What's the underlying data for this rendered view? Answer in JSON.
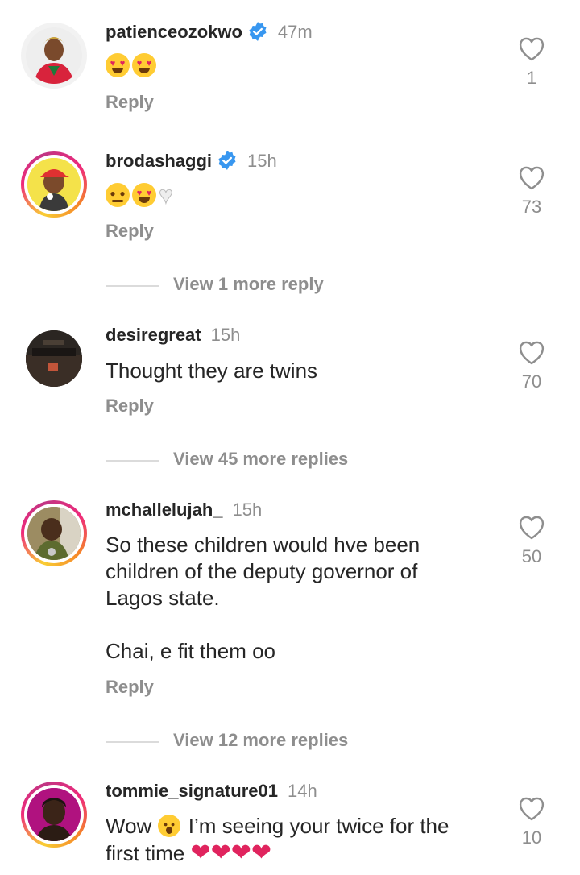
{
  "comments": [
    {
      "username": "patienceozokwo",
      "verified": true,
      "time": "47m",
      "text": "",
      "emojis": [
        "heart-eyes-face",
        "heart-eyes-face"
      ],
      "reply_label": "Reply",
      "likes": "1",
      "avatar": "patienceozokwo-avatar"
    },
    {
      "username": "brodashaggi",
      "verified": true,
      "time": "15h",
      "text": "",
      "emojis": [
        "pleading-face",
        "heart-eyes-face",
        "white-heart"
      ],
      "reply_label": "Reply",
      "likes": "73",
      "avatar": "brodashaggi-avatar",
      "view_more": "View 1 more reply"
    },
    {
      "username": "desiregreat",
      "verified": false,
      "time": "15h",
      "text": "Thought they are twins",
      "reply_label": "Reply",
      "likes": "70",
      "avatar": "desiregreat-avatar",
      "view_more": "View 45 more replies"
    },
    {
      "username": "mchallelujah_",
      "verified": false,
      "time": "15h",
      "text_lines": [
        "So these children would hve been",
        "children of the deputy governor of",
        "Lagos state.",
        "",
        "Chai, e fit them oo"
      ],
      "reply_label": "Reply",
      "likes": "50",
      "avatar": "mchallelujah-avatar",
      "view_more": "View 12 more replies"
    },
    {
      "username": "tommie_signature01",
      "verified": false,
      "time": "14h",
      "text_before_emoji": "Wow",
      "text_after_emoji": " I’m seeing your twice for the",
      "text_line2": "first time",
      "emojis": [
        "astonished-face",
        "red-heart",
        "red-heart",
        "red-heart",
        "red-heart"
      ],
      "likes": "10",
      "avatar": "tommie-signature01-avatar"
    }
  ],
  "colors": {
    "primary_text": "#262626",
    "secondary_text": "#8e8e8e",
    "verified_blue": "#3897f0",
    "divider": "#dbdbdb"
  }
}
